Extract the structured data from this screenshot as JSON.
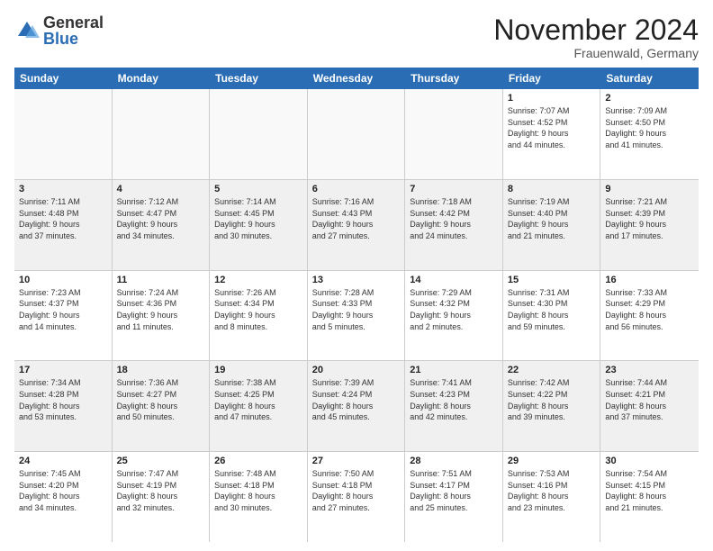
{
  "logo": {
    "general": "General",
    "blue": "Blue"
  },
  "title": "November 2024",
  "location": "Frauenwald, Germany",
  "days_of_week": [
    "Sunday",
    "Monday",
    "Tuesday",
    "Wednesday",
    "Thursday",
    "Friday",
    "Saturday"
  ],
  "weeks": [
    [
      {
        "day": "",
        "info": "",
        "empty": true
      },
      {
        "day": "",
        "info": "",
        "empty": true
      },
      {
        "day": "",
        "info": "",
        "empty": true
      },
      {
        "day": "",
        "info": "",
        "empty": true
      },
      {
        "day": "",
        "info": "",
        "empty": true
      },
      {
        "day": "1",
        "info": "Sunrise: 7:07 AM\nSunset: 4:52 PM\nDaylight: 9 hours\nand 44 minutes.",
        "empty": false
      },
      {
        "day": "2",
        "info": "Sunrise: 7:09 AM\nSunset: 4:50 PM\nDaylight: 9 hours\nand 41 minutes.",
        "empty": false
      }
    ],
    [
      {
        "day": "3",
        "info": "Sunrise: 7:11 AM\nSunset: 4:48 PM\nDaylight: 9 hours\nand 37 minutes.",
        "empty": false
      },
      {
        "day": "4",
        "info": "Sunrise: 7:12 AM\nSunset: 4:47 PM\nDaylight: 9 hours\nand 34 minutes.",
        "empty": false
      },
      {
        "day": "5",
        "info": "Sunrise: 7:14 AM\nSunset: 4:45 PM\nDaylight: 9 hours\nand 30 minutes.",
        "empty": false
      },
      {
        "day": "6",
        "info": "Sunrise: 7:16 AM\nSunset: 4:43 PM\nDaylight: 9 hours\nand 27 minutes.",
        "empty": false
      },
      {
        "day": "7",
        "info": "Sunrise: 7:18 AM\nSunset: 4:42 PM\nDaylight: 9 hours\nand 24 minutes.",
        "empty": false
      },
      {
        "day": "8",
        "info": "Sunrise: 7:19 AM\nSunset: 4:40 PM\nDaylight: 9 hours\nand 21 minutes.",
        "empty": false
      },
      {
        "day": "9",
        "info": "Sunrise: 7:21 AM\nSunset: 4:39 PM\nDaylight: 9 hours\nand 17 minutes.",
        "empty": false
      }
    ],
    [
      {
        "day": "10",
        "info": "Sunrise: 7:23 AM\nSunset: 4:37 PM\nDaylight: 9 hours\nand 14 minutes.",
        "empty": false
      },
      {
        "day": "11",
        "info": "Sunrise: 7:24 AM\nSunset: 4:36 PM\nDaylight: 9 hours\nand 11 minutes.",
        "empty": false
      },
      {
        "day": "12",
        "info": "Sunrise: 7:26 AM\nSunset: 4:34 PM\nDaylight: 9 hours\nand 8 minutes.",
        "empty": false
      },
      {
        "day": "13",
        "info": "Sunrise: 7:28 AM\nSunset: 4:33 PM\nDaylight: 9 hours\nand 5 minutes.",
        "empty": false
      },
      {
        "day": "14",
        "info": "Sunrise: 7:29 AM\nSunset: 4:32 PM\nDaylight: 9 hours\nand 2 minutes.",
        "empty": false
      },
      {
        "day": "15",
        "info": "Sunrise: 7:31 AM\nSunset: 4:30 PM\nDaylight: 8 hours\nand 59 minutes.",
        "empty": false
      },
      {
        "day": "16",
        "info": "Sunrise: 7:33 AM\nSunset: 4:29 PM\nDaylight: 8 hours\nand 56 minutes.",
        "empty": false
      }
    ],
    [
      {
        "day": "17",
        "info": "Sunrise: 7:34 AM\nSunset: 4:28 PM\nDaylight: 8 hours\nand 53 minutes.",
        "empty": false
      },
      {
        "day": "18",
        "info": "Sunrise: 7:36 AM\nSunset: 4:27 PM\nDaylight: 8 hours\nand 50 minutes.",
        "empty": false
      },
      {
        "day": "19",
        "info": "Sunrise: 7:38 AM\nSunset: 4:25 PM\nDaylight: 8 hours\nand 47 minutes.",
        "empty": false
      },
      {
        "day": "20",
        "info": "Sunrise: 7:39 AM\nSunset: 4:24 PM\nDaylight: 8 hours\nand 45 minutes.",
        "empty": false
      },
      {
        "day": "21",
        "info": "Sunrise: 7:41 AM\nSunset: 4:23 PM\nDaylight: 8 hours\nand 42 minutes.",
        "empty": false
      },
      {
        "day": "22",
        "info": "Sunrise: 7:42 AM\nSunset: 4:22 PM\nDaylight: 8 hours\nand 39 minutes.",
        "empty": false
      },
      {
        "day": "23",
        "info": "Sunrise: 7:44 AM\nSunset: 4:21 PM\nDaylight: 8 hours\nand 37 minutes.",
        "empty": false
      }
    ],
    [
      {
        "day": "24",
        "info": "Sunrise: 7:45 AM\nSunset: 4:20 PM\nDaylight: 8 hours\nand 34 minutes.",
        "empty": false
      },
      {
        "day": "25",
        "info": "Sunrise: 7:47 AM\nSunset: 4:19 PM\nDaylight: 8 hours\nand 32 minutes.",
        "empty": false
      },
      {
        "day": "26",
        "info": "Sunrise: 7:48 AM\nSunset: 4:18 PM\nDaylight: 8 hours\nand 30 minutes.",
        "empty": false
      },
      {
        "day": "27",
        "info": "Sunrise: 7:50 AM\nSunset: 4:18 PM\nDaylight: 8 hours\nand 27 minutes.",
        "empty": false
      },
      {
        "day": "28",
        "info": "Sunrise: 7:51 AM\nSunset: 4:17 PM\nDaylight: 8 hours\nand 25 minutes.",
        "empty": false
      },
      {
        "day": "29",
        "info": "Sunrise: 7:53 AM\nSunset: 4:16 PM\nDaylight: 8 hours\nand 23 minutes.",
        "empty": false
      },
      {
        "day": "30",
        "info": "Sunrise: 7:54 AM\nSunset: 4:15 PM\nDaylight: 8 hours\nand 21 minutes.",
        "empty": false
      }
    ]
  ]
}
